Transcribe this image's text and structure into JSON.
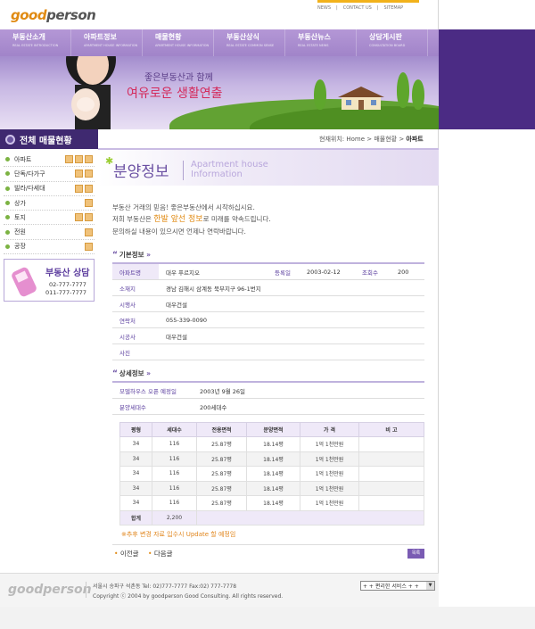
{
  "header": {
    "logo_prefix": "good",
    "logo_suffix": "person",
    "top_links": [
      "NEWS",
      "CONTACT US",
      "SITEMAP"
    ]
  },
  "gnb": [
    {
      "label": "부동산소개",
      "sub": "REAL ESTATE INTRODUCTION"
    },
    {
      "label": "아파트정보",
      "sub": "APARTMENT HOUSE INFORMATION"
    },
    {
      "label": "매물현황",
      "sub": "APARTMENT HOUSE INFORMATION"
    },
    {
      "label": "부동산상식",
      "sub": "REAL ESTATE COMMON SENSE"
    },
    {
      "label": "부동산뉴스",
      "sub": "REAL ESTATE NEWS"
    },
    {
      "label": "상담게시판",
      "sub": "CONSULTATION BOARD"
    }
  ],
  "visual": {
    "slogan_line1": "좋은부동산과 함께",
    "slogan_line2": "여유로운 생활연출"
  },
  "sidebar": {
    "title": "전체 매물현황",
    "items": [
      {
        "label": "아파트"
      },
      {
        "label": "단독/다가구"
      },
      {
        "label": "빌라/다세대"
      },
      {
        "label": "상가"
      },
      {
        "label": "토지"
      },
      {
        "label": "전원"
      },
      {
        "label": "공장"
      }
    ],
    "contact": {
      "title": "부동산 상담",
      "phone1": "02-777-7777",
      "phone2": "011-777-7777"
    }
  },
  "breadcrumb": {
    "prefix": "현재위치: Home > 매물현황 >",
    "current": "아파트"
  },
  "page_title": {
    "ko": "분양정보",
    "en_line1": "Apartment house",
    "en_line2": "Information"
  },
  "intro": {
    "line1": "부동산 거래의 믿음! 좋은부동산에서 시작하십시요.",
    "line2_a": "저희 부동산은",
    "line2_hl": "한발 앞선 정보",
    "line2_b": "로 미래를 약속드립니다.",
    "line3": "문의하실 내용이 있으시면 언제나 연락바랍니다."
  },
  "basic_info": {
    "section_title": "기본정보",
    "apt_name_label": "아파트명",
    "apt_name": "대우 푸르지오",
    "reg_date_label": "등록일",
    "reg_date": "2003-02-12",
    "views_label": "조회수",
    "views": "200",
    "rows": [
      {
        "label": "소재지",
        "value": "경남 김해시 삼계동 북부지구 96-1번지"
      },
      {
        "label": "시행사",
        "value": "대우건설"
      },
      {
        "label": "연락처",
        "value": "055-339-0090"
      },
      {
        "label": "시공사",
        "value": "대우건설"
      },
      {
        "label": "사진",
        "value": ""
      }
    ]
  },
  "detail_info": {
    "section_title": "상세정보",
    "model_open_label": "모델하우스 오픈 예정일",
    "model_open": "2003년 9월 26일",
    "units_label": "분양세대수",
    "units": "200세대수",
    "columns": [
      "평형",
      "세대수",
      "전용면적",
      "분양면적",
      "가 격",
      "비 고"
    ],
    "rows": [
      [
        "34",
        "116",
        "25.87평",
        "18.14평",
        "1억 1천만원",
        ""
      ],
      [
        "34",
        "116",
        "25.87평",
        "18.14평",
        "1억 1천만원",
        ""
      ],
      [
        "34",
        "116",
        "25.87평",
        "18.14평",
        "1억 1천만원",
        ""
      ],
      [
        "34",
        "116",
        "25.87평",
        "18.14평",
        "1억 1천만원",
        ""
      ],
      [
        "34",
        "116",
        "25.87평",
        "18.14평",
        "1억 1천만원",
        ""
      ]
    ],
    "total_label": "합계",
    "total_value": "2,200"
  },
  "notice": "※추후 변경 자료 입수시 Update 할 예정임",
  "pager": {
    "prev": "이전글",
    "next": "다음글",
    "list": "목록"
  },
  "footer": {
    "logo": "goodperson",
    "address": "서울시 송파구 석촌동   Tel: 02)777-7777   Fax:02) 777-7778",
    "copyright": "Copyright ⓒ 2004 by goodperson Good Consulting. All rights reserved.",
    "select_value": "+ + 편리한 서비스 + +"
  },
  "colors": {
    "brand_purple": "#4b2b84",
    "accent_orange": "#e08a12",
    "label_purple": "#5a3d9e"
  }
}
